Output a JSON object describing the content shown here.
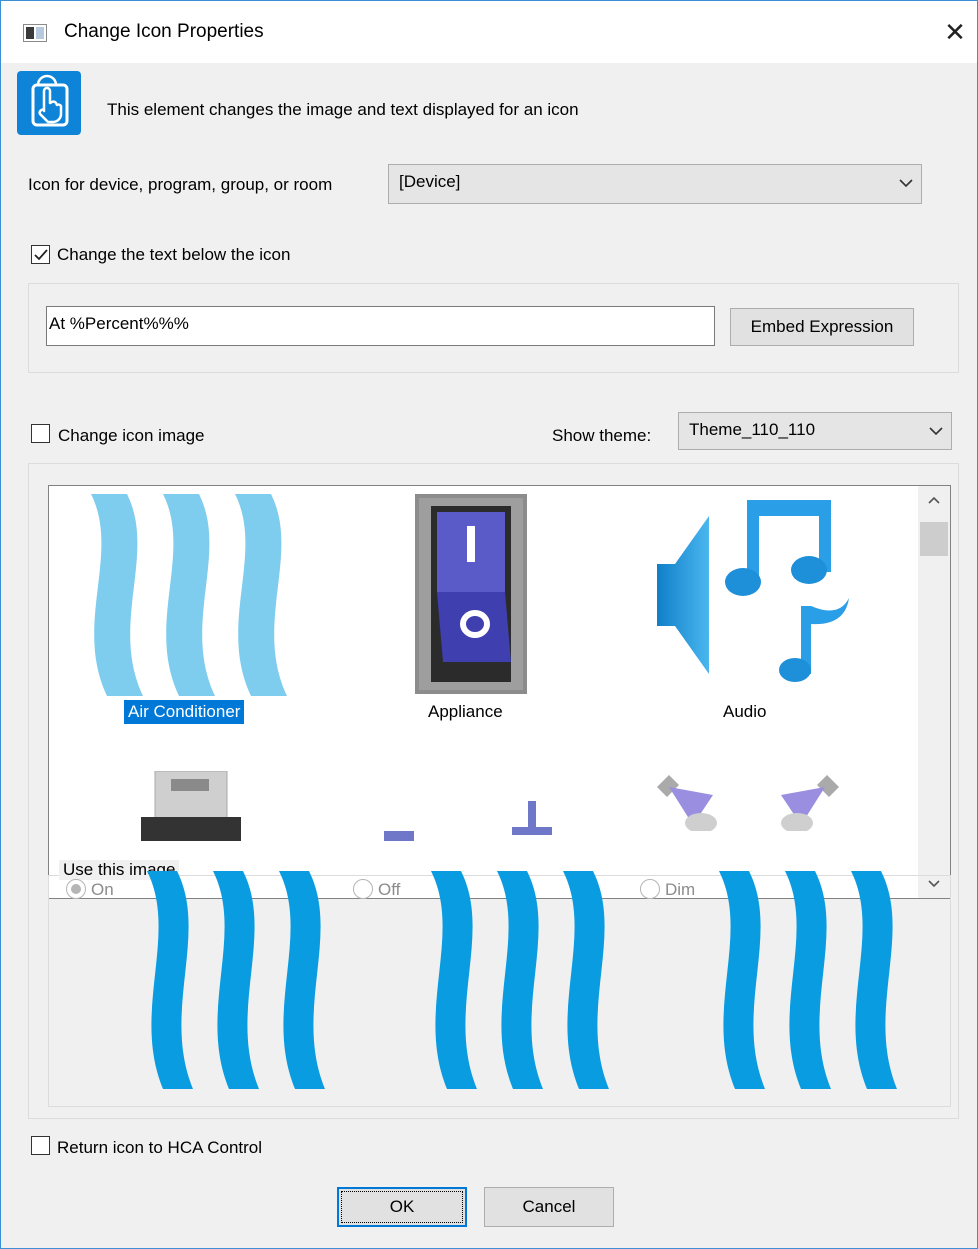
{
  "window": {
    "title": "Change Icon Properties",
    "close_glyph": "✕"
  },
  "intro": {
    "text": "This element changes the image and text displayed for an icon",
    "icon": "touch-hand-icon"
  },
  "icon_select": {
    "label": "Icon for device, program, group, or room",
    "value": "[Device]"
  },
  "change_text": {
    "label": "Change the text below the icon",
    "checked": true,
    "value": "At %Percent%%%",
    "embed_button": "Embed Expression"
  },
  "change_image": {
    "label": "Change icon image",
    "checked": false
  },
  "theme": {
    "label": "Show theme:",
    "value": "Theme_110_110"
  },
  "gallery": {
    "items": [
      {
        "label": "Air Conditioner",
        "selected": true,
        "icon": "air-conditioner-icon"
      },
      {
        "label": "Appliance",
        "selected": false,
        "icon": "appliance-switch-icon"
      },
      {
        "label": "Audio",
        "selected": false,
        "icon": "audio-icon"
      }
    ]
  },
  "use_image": {
    "legend": "Use this image",
    "options": [
      {
        "label": "On",
        "selected": true
      },
      {
        "label": "Off",
        "selected": false
      },
      {
        "label": "Dim",
        "selected": false
      }
    ]
  },
  "return_icon": {
    "label": "Return icon to HCA Control",
    "checked": false
  },
  "buttons": {
    "ok": "OK",
    "cancel": "Cancel"
  },
  "colors": {
    "accent": "#0078d7",
    "wave_light": "#7fcdee",
    "wave_dark": "#0a9ce0",
    "switch_blue": "#3f3fb0"
  }
}
